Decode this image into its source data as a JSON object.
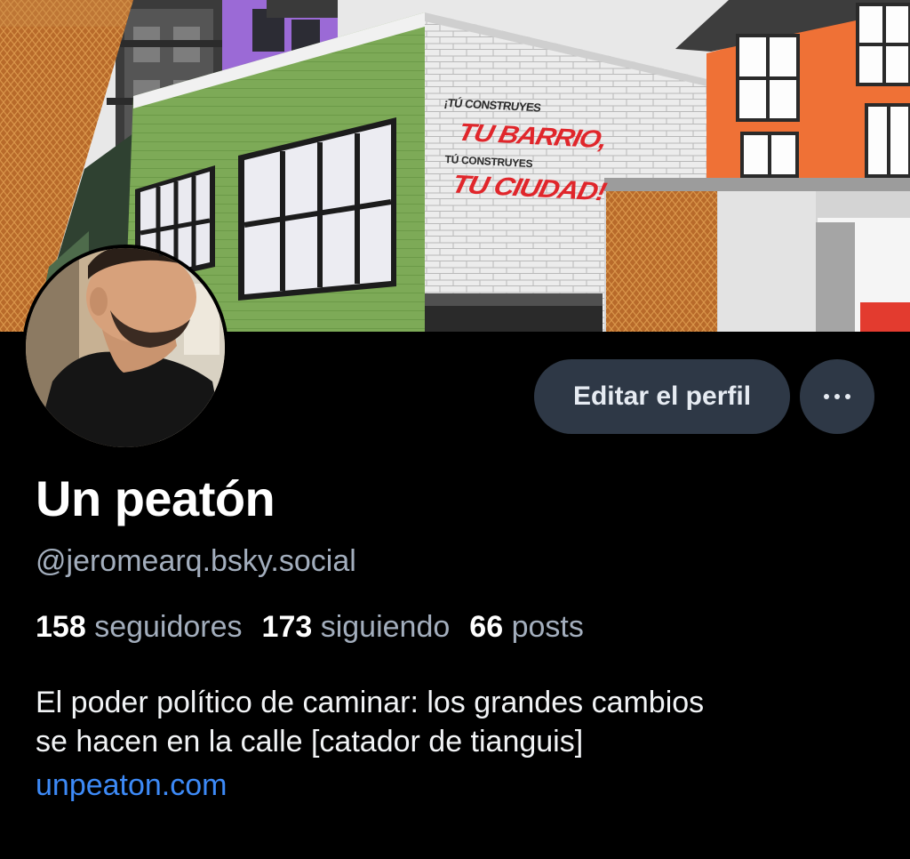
{
  "banner": {
    "mural_lines": [
      "¡TÚ CONSTRUYES",
      "TU BARRIO,",
      "TÚ CONSTRUYES",
      "TU CIUDAD!"
    ]
  },
  "profile": {
    "display_name": "Un peatón",
    "handle": "@jeromearq.bsky.social",
    "stats": [
      {
        "count": "158",
        "label": "seguidores"
      },
      {
        "count": "173",
        "label": "siguiendo"
      },
      {
        "count": "66",
        "label": "posts"
      }
    ],
    "bio_line1": "El poder político de caminar: los grandes cambios",
    "bio_line2": "se hacen en la calle [catador de tianguis]",
    "website": "unpeaton.com"
  },
  "actions": {
    "edit_label": "Editar el perfil",
    "more_icon": "ellipsis-icon"
  },
  "colors": {
    "background": "#000000",
    "button_bg": "#2e3846",
    "secondary_text": "#a3aebd",
    "link": "#3d8af7"
  }
}
